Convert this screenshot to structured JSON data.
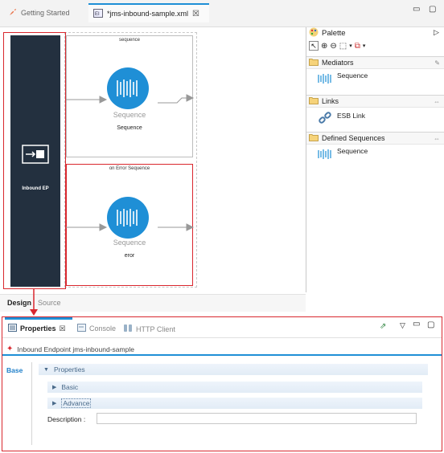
{
  "editor_tabs": [
    {
      "label": "Getting Started",
      "active": false
    },
    {
      "label": "*jms-inbound-sample.xml",
      "active": true
    }
  ],
  "canvas": {
    "inbound_ep_label": "Inbound EP",
    "sequence_box": {
      "title": "sequence",
      "icon_label": "Sequence",
      "name": "Sequence"
    },
    "error_box": {
      "title": "on Error Sequence",
      "icon_label": "Sequence",
      "name": "eror"
    },
    "bottom_tabs": {
      "design": "Design",
      "source": "Source"
    }
  },
  "palette": {
    "title": "Palette",
    "sections": [
      {
        "label": "Mediators",
        "items": [
          "Sequence"
        ]
      },
      {
        "label": "Links",
        "items": [
          "ESB Link"
        ]
      },
      {
        "label": "Defined Sequences",
        "items": [
          "Sequence"
        ]
      }
    ]
  },
  "properties_view": {
    "tabs": [
      {
        "label": "Properties",
        "active": true
      },
      {
        "label": "Console",
        "active": false
      },
      {
        "label": "HTTP Client",
        "active": false
      }
    ],
    "title": "Inbound Endpoint jms-inbound-sample",
    "side_tab": "Base",
    "group_label": "Properties",
    "sections": [
      "Basic",
      "Advance"
    ],
    "description_label": "Description :",
    "description_value": ""
  },
  "colors": {
    "accent": "#1f8fd6",
    "highlight": "#d9272e",
    "inbound_bg": "#23303f"
  }
}
